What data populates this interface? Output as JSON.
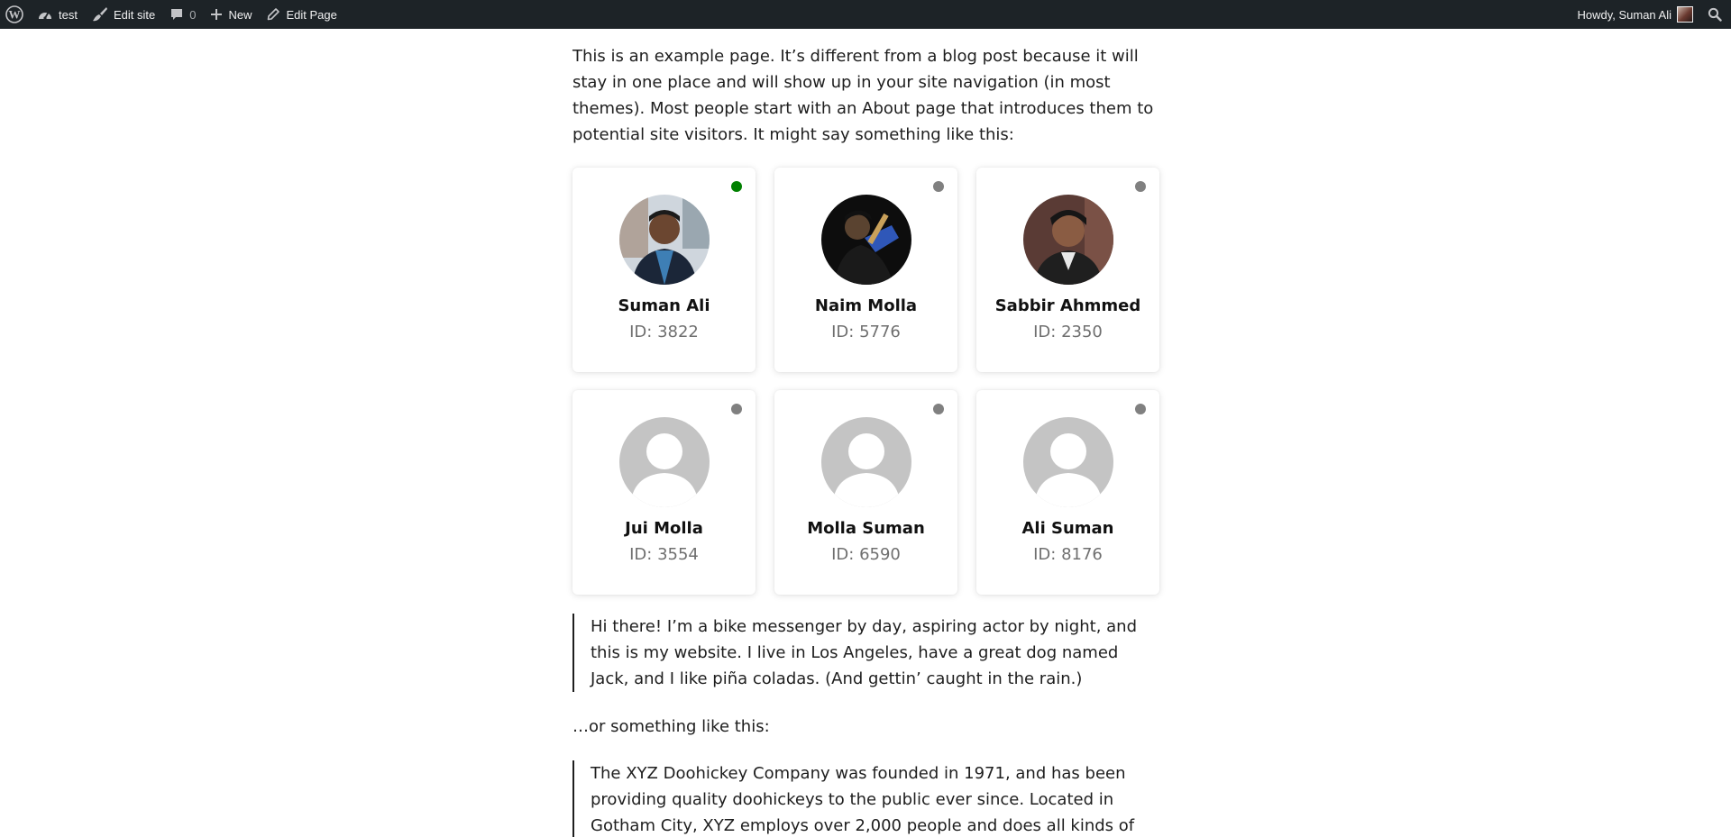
{
  "adminbar": {
    "site_name": "test",
    "edit_site": "Edit site",
    "comments_count": "0",
    "new": "New",
    "edit_page": "Edit Page",
    "greeting": "Howdy, Suman Ali"
  },
  "content": {
    "intro": "This is an example page. It’s different from a blog post because it will stay in one place and will show up in your site navigation (in most themes). Most people start with an About page that introduces them to potential site visitors. It might say something like this:",
    "users": [
      {
        "name": "Suman Ali",
        "id_text": "ID: 3822",
        "status_color": "#008000",
        "avatar": "photo"
      },
      {
        "name": "Naim Molla",
        "id_text": "ID: 5776",
        "status_color": "#808080",
        "avatar": "photo"
      },
      {
        "name": "Sabbir Ahmmed",
        "id_text": "ID: 2350",
        "status_color": "#808080",
        "avatar": "photo"
      },
      {
        "name": "Jui Molla",
        "id_text": "ID: 3554",
        "status_color": "#808080",
        "avatar": "default"
      },
      {
        "name": "Molla Suman",
        "id_text": "ID: 6590",
        "status_color": "#808080",
        "avatar": "default"
      },
      {
        "name": "Ali Suman",
        "id_text": "ID: 8176",
        "status_color": "#808080",
        "avatar": "default"
      }
    ],
    "quote1": "Hi there! I’m a bike messenger by day, aspiring actor by night, and this is my website. I live in Los Angeles, have a great dog named Jack, and I like piña coladas. (And gettin’ caught in the rain.)",
    "between": "…or something like this:",
    "quote2": "The XYZ Doohickey Company was founded in 1971, and has been providing quality doohickeys to the public ever since. Located in Gotham City, XYZ employs over 2,000 people and does all kinds of awesome things for the Gotham community."
  }
}
